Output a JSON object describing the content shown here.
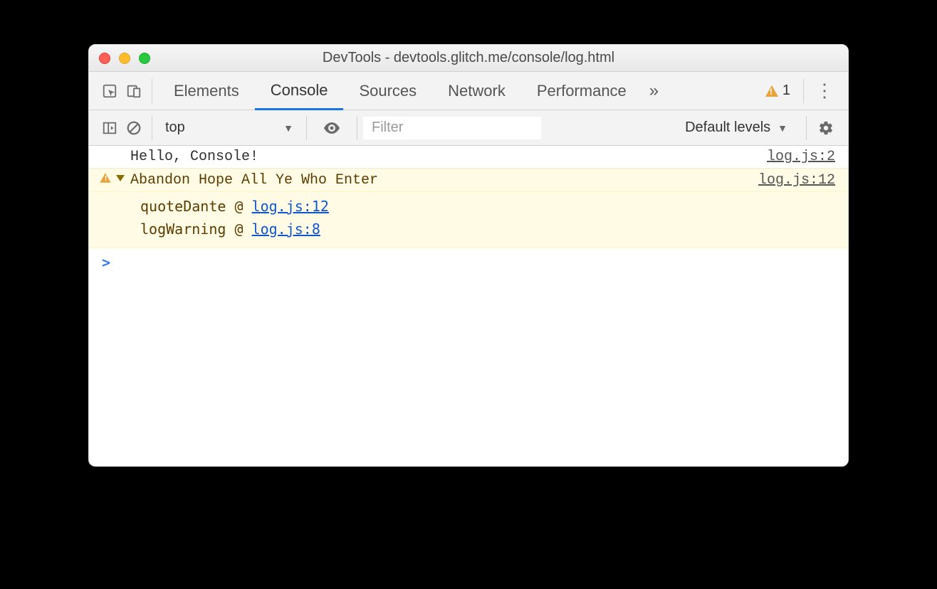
{
  "window": {
    "title": "DevTools - devtools.glitch.me/console/log.html"
  },
  "tabs": {
    "items": [
      "Elements",
      "Console",
      "Sources",
      "Network",
      "Performance"
    ],
    "active": "Console",
    "warning_count": "1"
  },
  "toolbar": {
    "context": "top",
    "filter_placeholder": "Filter",
    "levels_label": "Default levels"
  },
  "console": {
    "entries": [
      {
        "type": "log",
        "message": "Hello, Console!",
        "source": "log.js:2"
      },
      {
        "type": "warn",
        "message": "Abandon Hope All Ye Who Enter",
        "source": "log.js:12",
        "expanded": true,
        "stack": [
          {
            "fn": "quoteDante",
            "at": "log.js:12"
          },
          {
            "fn": "logWarning",
            "at": "log.js:8"
          }
        ]
      }
    ],
    "prompt": ">"
  }
}
